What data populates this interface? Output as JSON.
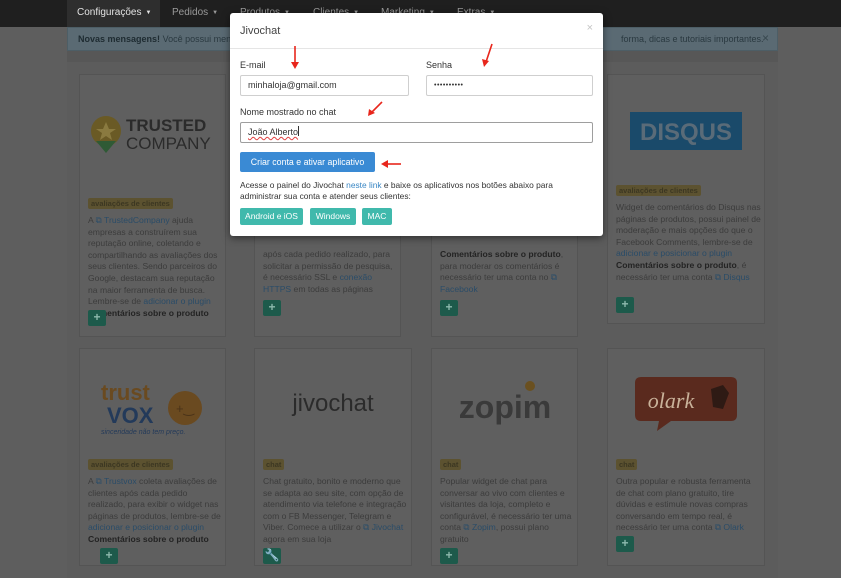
{
  "nav": {
    "items": [
      {
        "label": "Configurações"
      },
      {
        "label": "Pedidos"
      },
      {
        "label": "Produtos"
      },
      {
        "label": "Clientes"
      },
      {
        "label": "Marketing"
      },
      {
        "label": "Extras"
      }
    ]
  },
  "alert": {
    "strong": "Novas mensagens!",
    "text": "Você possui mensag",
    "text_end": "forma, dicas e tutoriais importantes."
  },
  "cards": [
    {
      "tag": "avaliações de clientes",
      "logo_text_1": "TRUSTED",
      "logo_text_2": "COMPANY",
      "desc_1": "A ",
      "link": "TrustedCompany",
      "desc_2": " ajuda empresas a construírem sua reputação online, coletando e compartilhando as avaliações dos seus clientes. Sendo parceiros do Google, destacam sua reputação na maior ferramenta de busca. Lembre-se de ",
      "link_2": "adicionar o plugin",
      "bold": "Comentários sobre o produto"
    },
    {
      "desc_1": "após cada pedido realizado, para solicitar a permissão de pesquisa, é necessário SSL e ",
      "link": "conexão HTTPS",
      "desc_2": " em todas as páginas"
    },
    {
      "bold": "Comentários sobre o produto",
      "desc_1": ", para moderar os comentários é necessário ter uma conta no ",
      "link": "Facebook"
    },
    {
      "tag": "avaliações de clientes",
      "logo_text": "DISQUS",
      "desc_1": "Widget de comentários do Disqus nas páginas de produtos, possui painel de moderação e mais opções do que o Facebook Comments, lembre-se de ",
      "link": "adicionar e posicionar o plugin",
      "bold": "Comentários sobre o produto",
      "desc_2": ", é necessário ter uma conta ",
      "link_2": "Disqus"
    },
    {
      "tag": "avaliações de clientes",
      "logo_text_1": "trust",
      "logo_text_2": "VOX",
      "logo_sub": "sinceridade não tem preço.",
      "desc_1": "A ",
      "link": "Trustvox",
      "desc_2": " coleta avaliações de clientes após cada pedido realizado, para exibir o widget nas páginas de produtos, lembre-se de ",
      "link_2": "adicionar e posicionar o plugin",
      "bold": "Comentários sobre o produto"
    },
    {
      "tag": "chat",
      "logo_text": "jivochat",
      "desc_1": "Chat gratuito, bonito e moderno que se adapta ao seu site, com opção de atendimento via telefone e integração com o FB Messenger, Telegram e Viber. Comece a utilizar o ",
      "link": "Jivochat",
      "desc_2": " agora em sua loja"
    },
    {
      "tag": "chat",
      "logo_text": "zopim",
      "desc_1": "Popular widget de chat para conversar ao vivo com clientes e visitantes da loja, completo e configurável, é necessário ter uma conta ",
      "link": "Zopim",
      "desc_2": ", possui plano gratuito"
    },
    {
      "tag": "chat",
      "logo_text": "olark",
      "desc_1": "Outra popular e robusta ferramenta de chat com plano gratuito, tire dúvidas e estimule novas compras conversando em tempo real, é necessário ter uma conta ",
      "link": "Olark"
    }
  ],
  "modal": {
    "title": "Jivochat",
    "close": "×",
    "email_label": "E-mail",
    "email_value": "minhaloja@gmail.com",
    "password_label": "Senha",
    "password_value": "••••••••••",
    "name_label": "Nome mostrado no chat",
    "name_value": "João Alberto",
    "submit_label": "Criar conta e ativar aplicativo",
    "help_1": "Acesse o painel do Jivochat ",
    "help_link": "neste link",
    "help_2": " e baixe os aplicativos nos botões abaixo para administrar sua conta e atender seus clientes:",
    "downloads": [
      {
        "label": "Android e iOS"
      },
      {
        "label": "Windows"
      },
      {
        "label": "MAC"
      }
    ]
  },
  "colors": {
    "primary": "#3a8ad4",
    "download": "#40b9ac",
    "arrow": "#e8261c",
    "plus_button": "#1d5a4b"
  }
}
